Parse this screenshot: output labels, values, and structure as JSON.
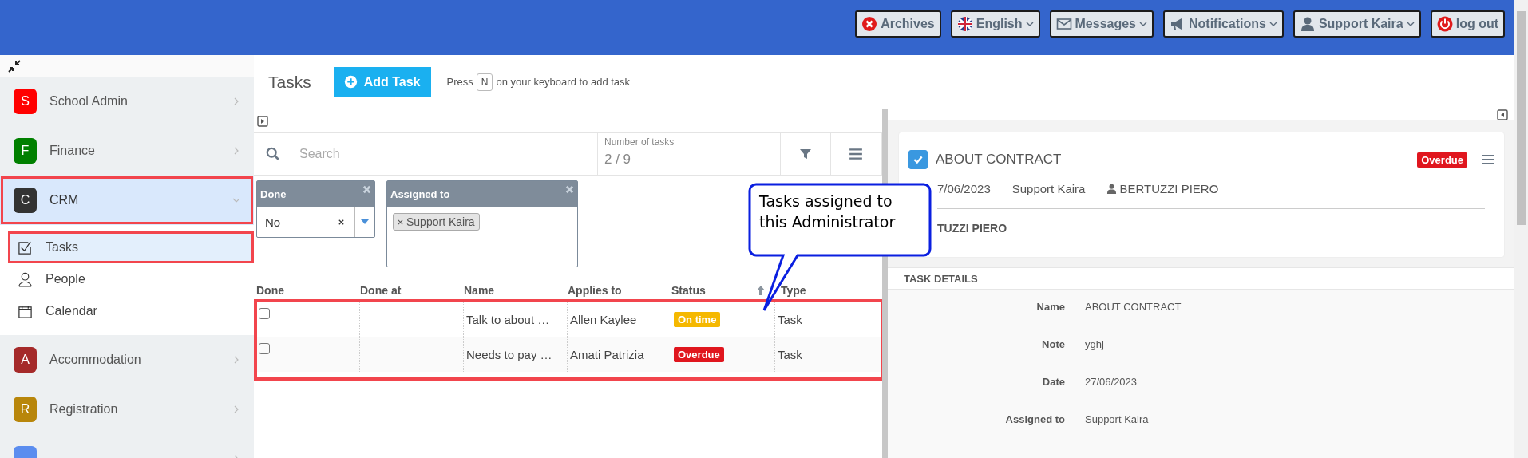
{
  "topbar": {
    "buttons": [
      {
        "label": "Archives",
        "caret": false
      },
      {
        "label": "English",
        "caret": true
      },
      {
        "label": "Messages",
        "caret": true
      },
      {
        "label": "Notifications",
        "caret": true
      },
      {
        "label": "Support Kaira",
        "caret": true
      },
      {
        "label": "log out",
        "caret": false
      }
    ]
  },
  "sidebar": {
    "items": [
      {
        "letter": "S",
        "label": "School Admin",
        "color": "#ff0000",
        "expanded": false,
        "selected": false,
        "annotated": false
      },
      {
        "letter": "F",
        "label": "Finance",
        "color": "#008000",
        "expanded": false,
        "selected": false,
        "annotated": false
      },
      {
        "letter": "C",
        "label": "CRM",
        "color": "#333333",
        "expanded": true,
        "selected": true,
        "annotated": true,
        "children": [
          {
            "label": "Tasks",
            "selected": true,
            "annotated": true
          },
          {
            "label": "People",
            "selected": false,
            "annotated": false
          },
          {
            "label": "Calendar",
            "selected": false,
            "annotated": false
          }
        ]
      },
      {
        "letter": "A",
        "label": "Accommodation",
        "color": "#a52a2a",
        "expanded": false,
        "selected": false,
        "annotated": false
      },
      {
        "letter": "R",
        "label": "Registration",
        "color": "#b8860b",
        "expanded": false,
        "selected": false,
        "annotated": false
      },
      {
        "color": "#5b8def",
        "expanded": false,
        "selected": false,
        "annotated": false
      }
    ]
  },
  "header": {
    "title": "Tasks",
    "add_button": "Add Task",
    "hint_before": "Press",
    "hint_key": "N",
    "hint_after": "on your keyboard to add task"
  },
  "list": {
    "search": {
      "placeholder": "Search"
    },
    "count_label": "Number of tasks",
    "count": "2 / 9",
    "filters": [
      {
        "kind": "select",
        "title": "Done",
        "value": "No"
      },
      {
        "kind": "tags",
        "title": "Assigned to",
        "tags": [
          "Support Kaira"
        ]
      }
    ],
    "table": {
      "columns": [
        "Done",
        "Done at",
        "Name",
        "Applies to",
        "Status",
        "Type"
      ],
      "annotated": true,
      "rows": [
        {
          "done": false,
          "done_at": "",
          "name": "Talk to about …",
          "applies_to": "Allen Kaylee",
          "status": {
            "text": "On time",
            "color": "#f5b800"
          },
          "type": "Task"
        },
        {
          "done": false,
          "done_at": "",
          "name": "Needs to pay …",
          "applies_to": "Amati Patrizia",
          "status": {
            "text": "Overdue",
            "color": "#e0161e"
          },
          "type": "Task"
        }
      ]
    }
  },
  "callout": {
    "text": "Tasks assigned to this Administrator"
  },
  "detail": {
    "title": "ABOUT CONTRACT",
    "checked": true,
    "status": {
      "text": "Overdue",
      "color": "#e0161e"
    },
    "date": "7/06/2023",
    "assignee": "Support Kaira",
    "contact": "BERTUZZI PIERO",
    "contact_line": "TUZZI PIERO",
    "section": "TASK DETAILS",
    "fields": [
      {
        "label": "Name",
        "value": "ABOUT CONTRACT"
      },
      {
        "label": "Note",
        "value": "yghj"
      },
      {
        "label": "Date",
        "value": "27/06/2023"
      },
      {
        "label": "Assigned to",
        "value": "Support Kaira"
      }
    ]
  }
}
